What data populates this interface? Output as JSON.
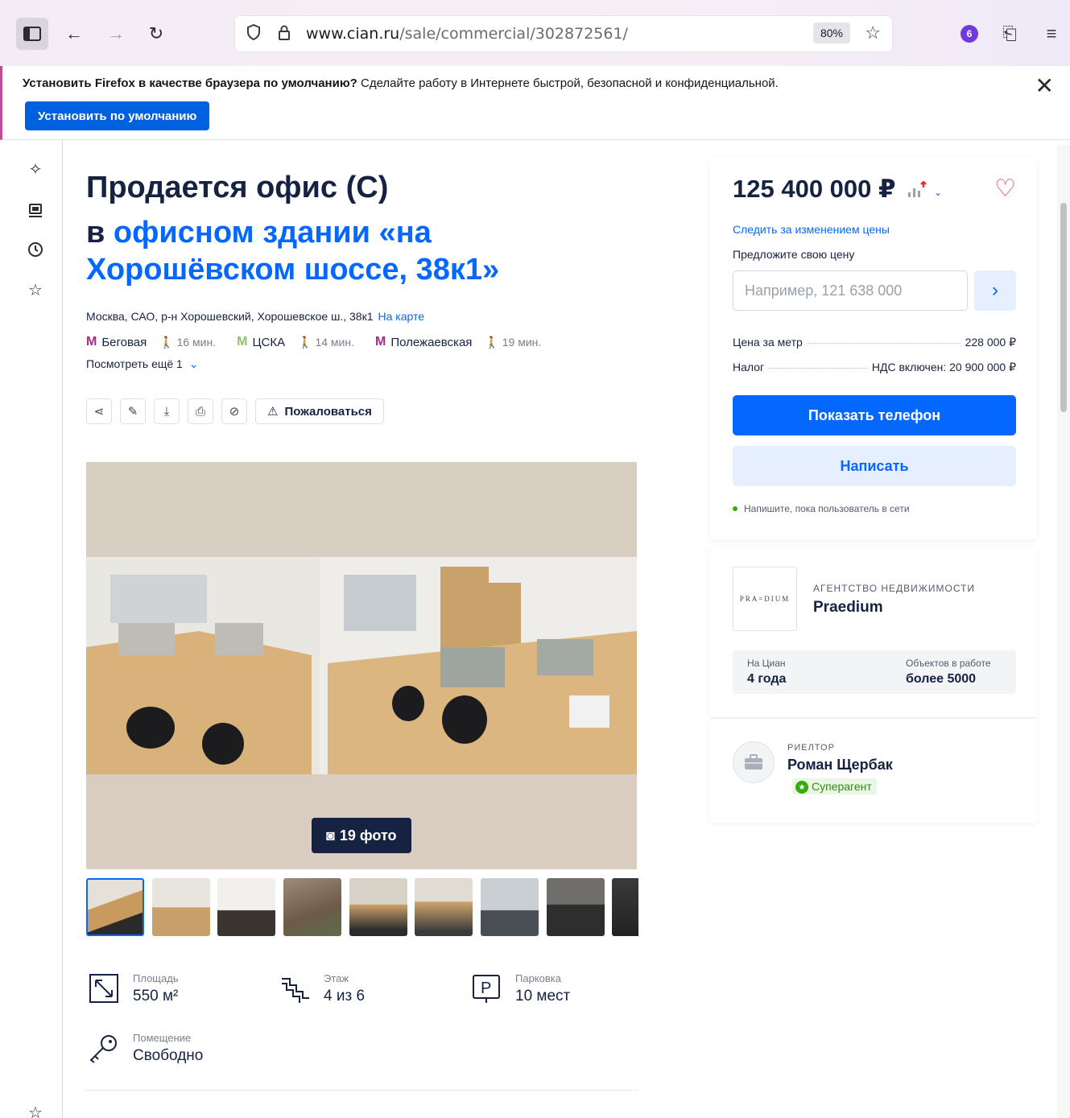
{
  "browser": {
    "url_domain": "www.cian.ru",
    "url_path": "/sale/commercial/302872561/",
    "zoom": "80%",
    "ext_count": "6"
  },
  "notice": {
    "bold": "Установить Firefox в качестве браузера по умолчанию?",
    "text": " Сделайте работу в Интернете быстрой, безопасной и конфиденциальной.",
    "button": "Установить по умолчанию",
    "close": "✕"
  },
  "listing": {
    "title_line1": "Продается офис (C)",
    "title_prefix": "в ",
    "title_link": "офисном здании «на Хорошёвском шоссе, 38к1»",
    "address": "Москва, САО, р-н Хорошевский, Хорошевское ш., 38к1",
    "map_link": "На карте",
    "metro": [
      {
        "name": "Беговая",
        "walk": "16 мин.",
        "color": "#a62d86"
      },
      {
        "name": "ЦСКА",
        "walk": "14 мин.",
        "color": "#8fc26a"
      },
      {
        "name": "Полежаевская",
        "walk": "19 мин.",
        "color": "#a62d86"
      }
    ],
    "more": "Посмотреть ещё 1",
    "complain": "Пожаловаться",
    "photo_count": "19 фото"
  },
  "features": [
    {
      "label": "Площадь",
      "value": "550 м²"
    },
    {
      "label": "Этаж",
      "value": "4 из 6"
    },
    {
      "label": "Парковка",
      "value": "10 мест"
    },
    {
      "label": "Помещение",
      "value": "Свободно"
    }
  ],
  "price": {
    "value": "125 400 000 ₽",
    "watch": "Следить за изменением цены",
    "offer_label": "Предложите свою цену",
    "offer_placeholder": "Например, 121 638 000",
    "per_meter_label": "Цена за метр",
    "per_meter_value": "228 000 ₽",
    "tax_label": "Налог",
    "tax_value": "НДС включен: 20 900 000 ₽",
    "show_phone": "Показать телефон",
    "write": "Написать",
    "online": "Напишите, пока пользователь в сети"
  },
  "agency": {
    "logo_text": "PRA=DIUM",
    "type": "АГЕНТСТВО НЕДВИЖИМОСТИ",
    "name": "Praedium",
    "on_cian_label": "На Циан",
    "on_cian_value": "4 года",
    "objects_label": "Объектов в работе",
    "objects_value": "более 5000"
  },
  "realtor": {
    "type": "РИЕЛТОР",
    "name": "Роман Щербак",
    "badge": "Суперагент"
  }
}
